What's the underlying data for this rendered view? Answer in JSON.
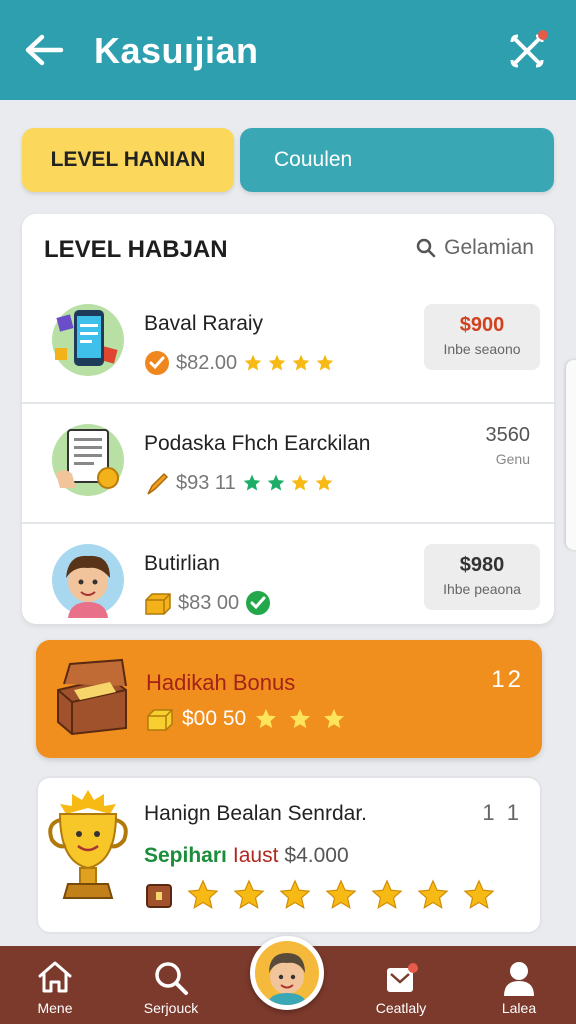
{
  "header": {
    "title": "Kasuıjian"
  },
  "tabs": [
    {
      "label": "LEVEL HANIAN"
    },
    {
      "label": "Couulen"
    }
  ],
  "card": {
    "title": "LEVEL HABJAN",
    "search_label": "Gelamian",
    "rows": [
      {
        "name": "Baval Raraiy",
        "amount": "$82.00",
        "price": "$900",
        "price_sub": "Inbe seaono",
        "stars": 4
      },
      {
        "name": "Podaska Fhch Earckilan",
        "amount": "$93 11",
        "price": "3560",
        "price_sub": "Genu",
        "stars": 4
      },
      {
        "name": "Butirlian",
        "amount": "$83 00",
        "price": "$980",
        "price_sub": "Ihbe peaona",
        "stars": 0
      }
    ]
  },
  "bonus": {
    "title": "Hadikah Bonus",
    "amount": "$00 50",
    "count": "12",
    "stars": 3
  },
  "award": {
    "title": "Hanign Bealan Senrdar.",
    "green": "Sepiharı",
    "red": "Iaust",
    "value": "$4.000",
    "count": "1 1",
    "stars": 7
  },
  "nav": [
    {
      "label": "Mene"
    },
    {
      "label": "Serjouck"
    },
    {
      "label": "Ceatlaly"
    },
    {
      "label": "Lalea"
    }
  ],
  "colors": {
    "header": "#2e9fae",
    "tab_active": "#fbd75b",
    "bonus": "#f18f1e",
    "nav": "#7c3a2c",
    "star": "#f7b914"
  }
}
